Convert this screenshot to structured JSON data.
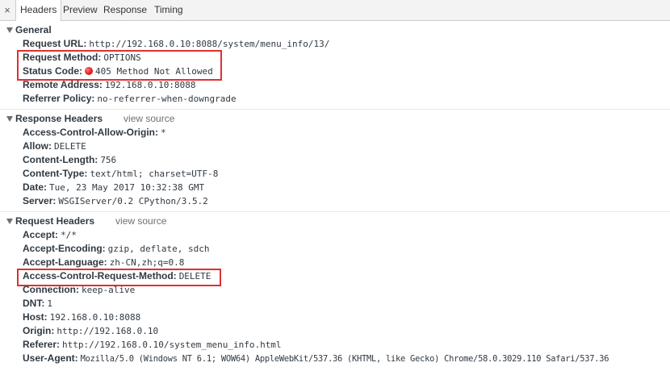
{
  "tabs": {
    "close": "×",
    "items": [
      "Headers",
      "Preview",
      "Response",
      "Timing"
    ],
    "selected": "Headers"
  },
  "general": {
    "title": "General",
    "rows": [
      {
        "key": "Request URL:",
        "value": "http://192.168.0.10:8088/system/menu_info/13/"
      },
      {
        "key": "Request Method:",
        "value": "OPTIONS"
      },
      {
        "key": "Status Code:",
        "value": "405 Method Not Allowed"
      },
      {
        "key": "Remote Address:",
        "value": "192.168.0.10:8088"
      },
      {
        "key": "Referrer Policy:",
        "value": "no-referrer-when-downgrade"
      }
    ]
  },
  "response_headers": {
    "title": "Response Headers",
    "view_source": "view source",
    "rows": [
      {
        "key": "Access-Control-Allow-Origin:",
        "value": "*"
      },
      {
        "key": "Allow:",
        "value": "DELETE"
      },
      {
        "key": "Content-Length:",
        "value": "756"
      },
      {
        "key": "Content-Type:",
        "value": "text/html; charset=UTF-8"
      },
      {
        "key": "Date:",
        "value": "Tue, 23 May 2017 10:32:38 GMT"
      },
      {
        "key": "Server:",
        "value": "WSGIServer/0.2 CPython/3.5.2"
      }
    ]
  },
  "request_headers": {
    "title": "Request Headers",
    "view_source": "view source",
    "rows": [
      {
        "key": "Accept:",
        "value": "*/*"
      },
      {
        "key": "Accept-Encoding:",
        "value": "gzip, deflate, sdch"
      },
      {
        "key": "Accept-Language:",
        "value": "zh-CN,zh;q=0.8"
      },
      {
        "key": "Access-Control-Request-Method:",
        "value": "DELETE"
      },
      {
        "key": "Connection:",
        "value": "keep-alive"
      },
      {
        "key": "DNT:",
        "value": "1"
      },
      {
        "key": "Host:",
        "value": "192.168.0.10:8088"
      },
      {
        "key": "Origin:",
        "value": "http://192.168.0.10"
      },
      {
        "key": "Referer:",
        "value": "http://192.168.0.10/system_menu_info.html"
      },
      {
        "key": "User-Agent:",
        "value": "Mozilla/5.0 (Windows NT 6.1; WOW64) AppleWebKit/537.36 (KHTML, like Gecko) Chrome/58.0.3029.110 Safari/537.36"
      }
    ]
  },
  "colors": {
    "highlight_box": "#e03030",
    "status_dot": "#e0201f"
  }
}
